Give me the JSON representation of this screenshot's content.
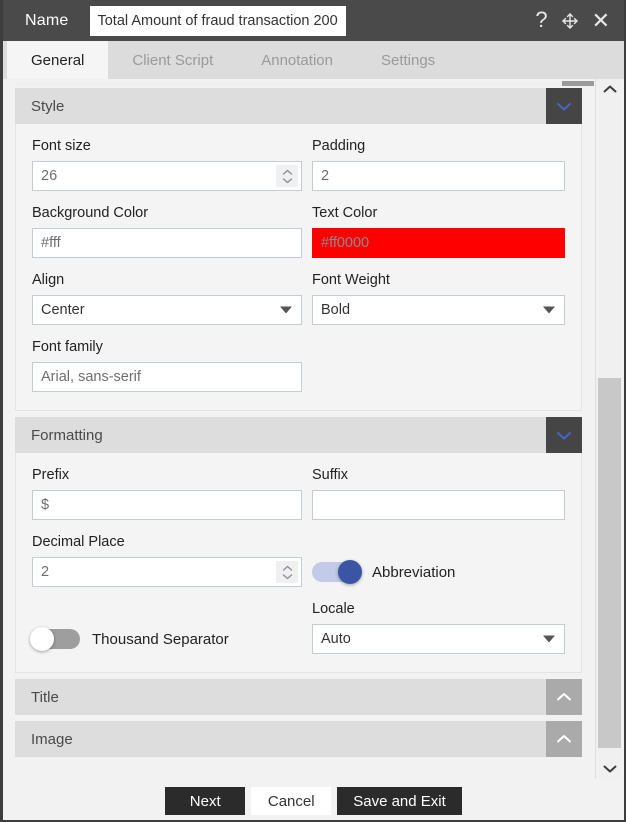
{
  "titlebar": {
    "name_label": "Name",
    "name_value": "Total Amount of fraud transaction 200",
    "help_icon": "question-mark-icon",
    "move_icon": "move-arrows-icon",
    "close_icon": "close-x-icon"
  },
  "tabs": [
    {
      "label": "General",
      "active": true
    },
    {
      "label": "Client Script",
      "active": false
    },
    {
      "label": "Annotation",
      "active": false
    },
    {
      "label": "Settings",
      "active": false
    }
  ],
  "sections": {
    "style": {
      "title": "Style",
      "state": "expanded",
      "fields": {
        "font_size_label": "Font size",
        "font_size_value": "26",
        "padding_label": "Padding",
        "padding_value": "2",
        "background_color_label": "Background Color",
        "background_color_value": "#fff",
        "text_color_label": "Text Color",
        "text_color_value": "#ff0000",
        "text_color_swatch": "#ff0000",
        "align_label": "Align",
        "align_value": "Center",
        "font_weight_label": "Font Weight",
        "font_weight_value": "Bold",
        "font_family_label": "Font family",
        "font_family_value": "Arial, sans-serif"
      }
    },
    "formatting": {
      "title": "Formatting",
      "state": "expanded",
      "fields": {
        "prefix_label": "Prefix",
        "prefix_value": "$",
        "suffix_label": "Suffix",
        "suffix_value": "",
        "decimal_place_label": "Decimal Place",
        "decimal_place_value": "2",
        "abbreviation_label": "Abbreviation",
        "abbreviation_on": true,
        "thousand_separator_label": "Thousand Separator",
        "thousand_separator_on": false,
        "locale_label": "Locale",
        "locale_value": "Auto"
      }
    },
    "title_section": {
      "title": "Title",
      "state": "collapsed"
    },
    "image_section": {
      "title": "Image",
      "state": "collapsed"
    }
  },
  "footer": {
    "next_label": "Next",
    "cancel_label": "Cancel",
    "save_label": "Save and Exit"
  },
  "colors": {
    "titlebar_bg": "#4a4a4a",
    "accent_blue": "#3b55a4",
    "text_color_value": "#ff0000",
    "section_header_bg": "#dddddd",
    "button_dark": "#2b2b2b"
  }
}
